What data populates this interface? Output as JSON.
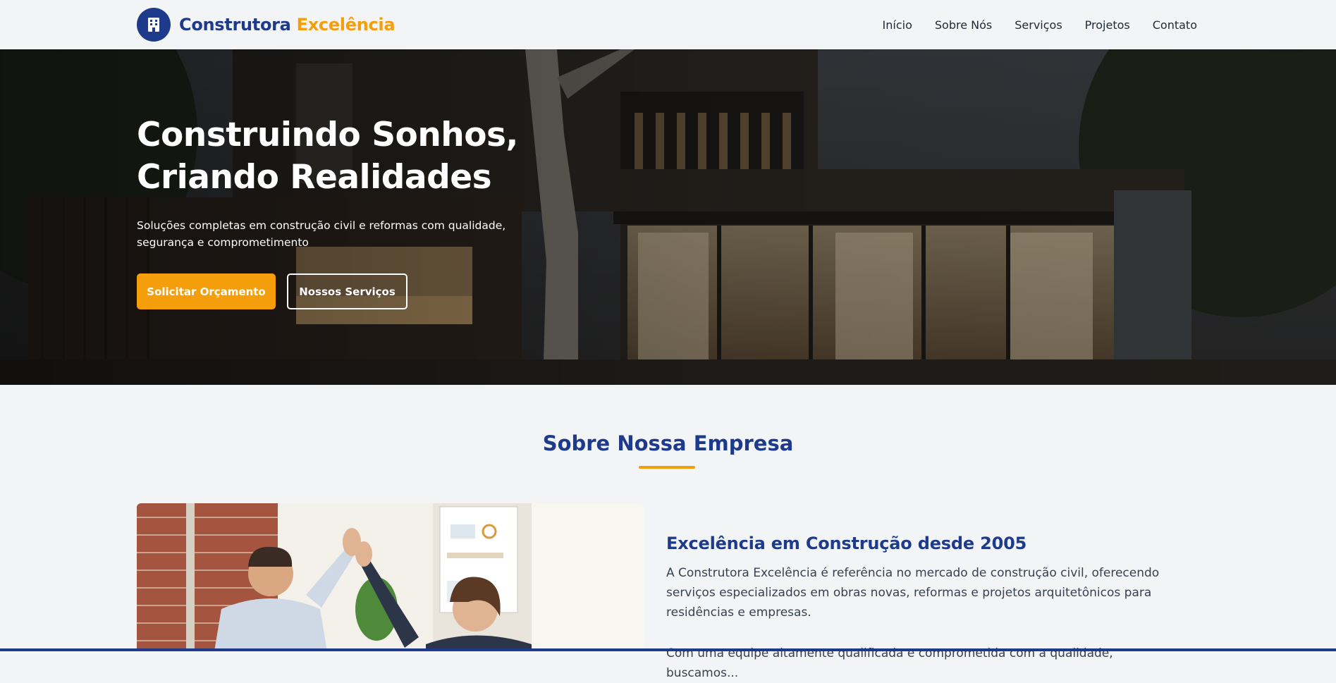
{
  "header": {
    "brand_part1": "Construtora",
    "brand_part2": "Excelência",
    "logo_icon": "building-icon",
    "nav": [
      "Início",
      "Sobre Nós",
      "Serviços",
      "Projetos",
      "Contato"
    ]
  },
  "hero": {
    "title": "Construindo Sonhos, Criando Realidades",
    "subtitle": "Soluções completas em construção civil e reformas com qualidade, segurança e comprometimento",
    "primary_button": "Solicitar Orçamento",
    "secondary_button": "Nossos Serviços"
  },
  "about": {
    "heading": "Sobre Nossa Empresa",
    "subtitle": "Excelência em Construção desde 2005",
    "paragraph1": "A Construtora Excelência é referência no mercado de construção civil, oferecendo serviços especializados em obras novas, reformas e projetos arquitetônicos para residências e empresas.",
    "paragraph2": "Com uma equipe altamente qualificada e comprometida com a qualidade, buscamos..."
  },
  "colors": {
    "primary": "#1e3a8a",
    "accent": "#f59e0b",
    "background": "#f3f4f6"
  }
}
